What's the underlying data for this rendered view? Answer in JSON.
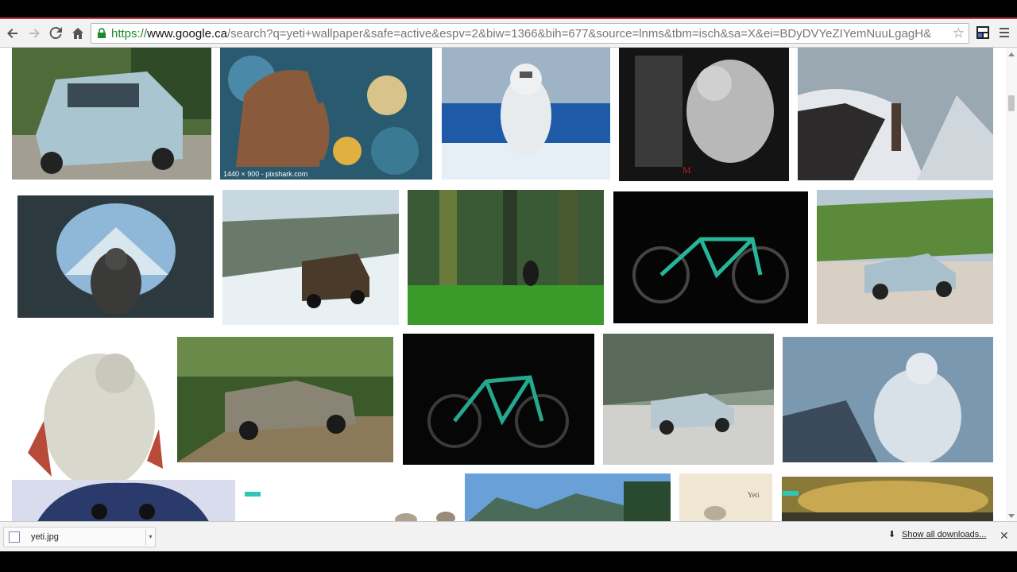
{
  "browser": {
    "url_scheme": "https://",
    "url_host": "www.google.ca",
    "url_path": "/search?q=yeti+wallpaper&safe=active&espv=2&biw=1366&bih=677&source=lnms&tbm=isch&sa=X&ei=BDyDVYeZIYemNuuLgagH&"
  },
  "results": {
    "caption_mammoth": "1440 × 900 - pixshark.com",
    "caption_yeti_sign": "Yeti"
  },
  "downloads": {
    "file_name": "yeti.jpg",
    "show_all_label": "Show all downloads...",
    "close_glyph": "✕"
  },
  "colors": {
    "tab_accent": "#c8343b",
    "url_scheme": "#1a8a2a",
    "teal_marker": "#2cc7b6"
  },
  "icons": [
    "back-icon",
    "forward-icon",
    "reload-icon",
    "home-icon",
    "lock-icon",
    "star-icon",
    "extension-icon",
    "menu-icon",
    "file-icon",
    "download-arrow-icon",
    "close-icon"
  ]
}
